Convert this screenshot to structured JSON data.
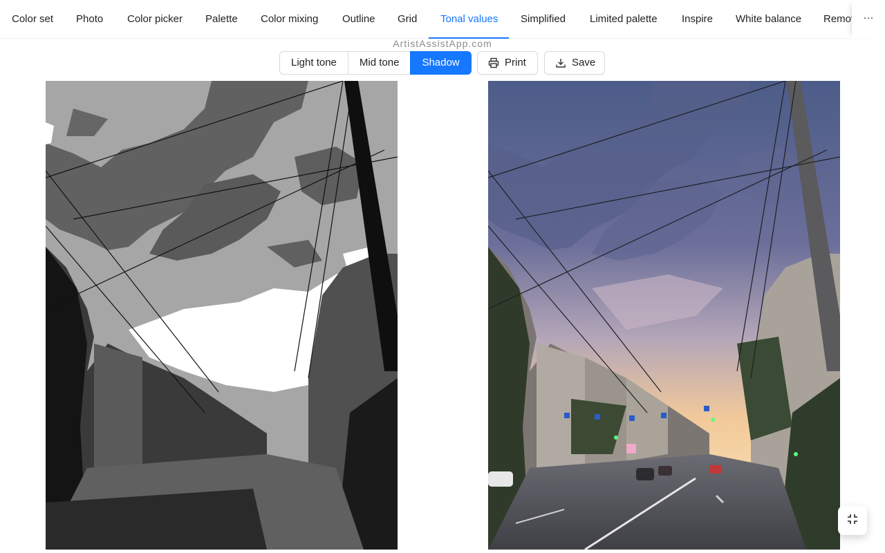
{
  "tabs": [
    {
      "label": "Color set",
      "active": false
    },
    {
      "label": "Photo",
      "active": false
    },
    {
      "label": "Color picker",
      "active": false
    },
    {
      "label": "Palette",
      "active": false
    },
    {
      "label": "Color mixing",
      "active": false
    },
    {
      "label": "Outline",
      "active": false
    },
    {
      "label": "Grid",
      "active": false
    },
    {
      "label": "Tonal values",
      "active": true
    },
    {
      "label": "Simplified",
      "active": false
    },
    {
      "label": "Limited palette",
      "active": false
    },
    {
      "label": "Inspire",
      "active": false
    },
    {
      "label": "White balance",
      "active": false
    },
    {
      "label": "Remov",
      "active": false
    }
  ],
  "tabs_more_label": "···",
  "watermark": "ArtistAssistApp.com",
  "tone_selector": {
    "options": [
      "Light tone",
      "Mid tone",
      "Shadow"
    ],
    "selected": "Shadow"
  },
  "actions": {
    "print_label": "Print",
    "save_label": "Save"
  },
  "icons": {
    "print": "printer-icon",
    "save": "download-icon",
    "fullscreen_exit": "fullscreen-exit-icon",
    "more": "ellipsis-icon"
  },
  "colors": {
    "accent": "#1677ff",
    "border": "#d9d9d9",
    "watermark": "#8c8c8c"
  },
  "images": {
    "left": "tonal-values-shadow-preview",
    "right": "original-photo"
  }
}
